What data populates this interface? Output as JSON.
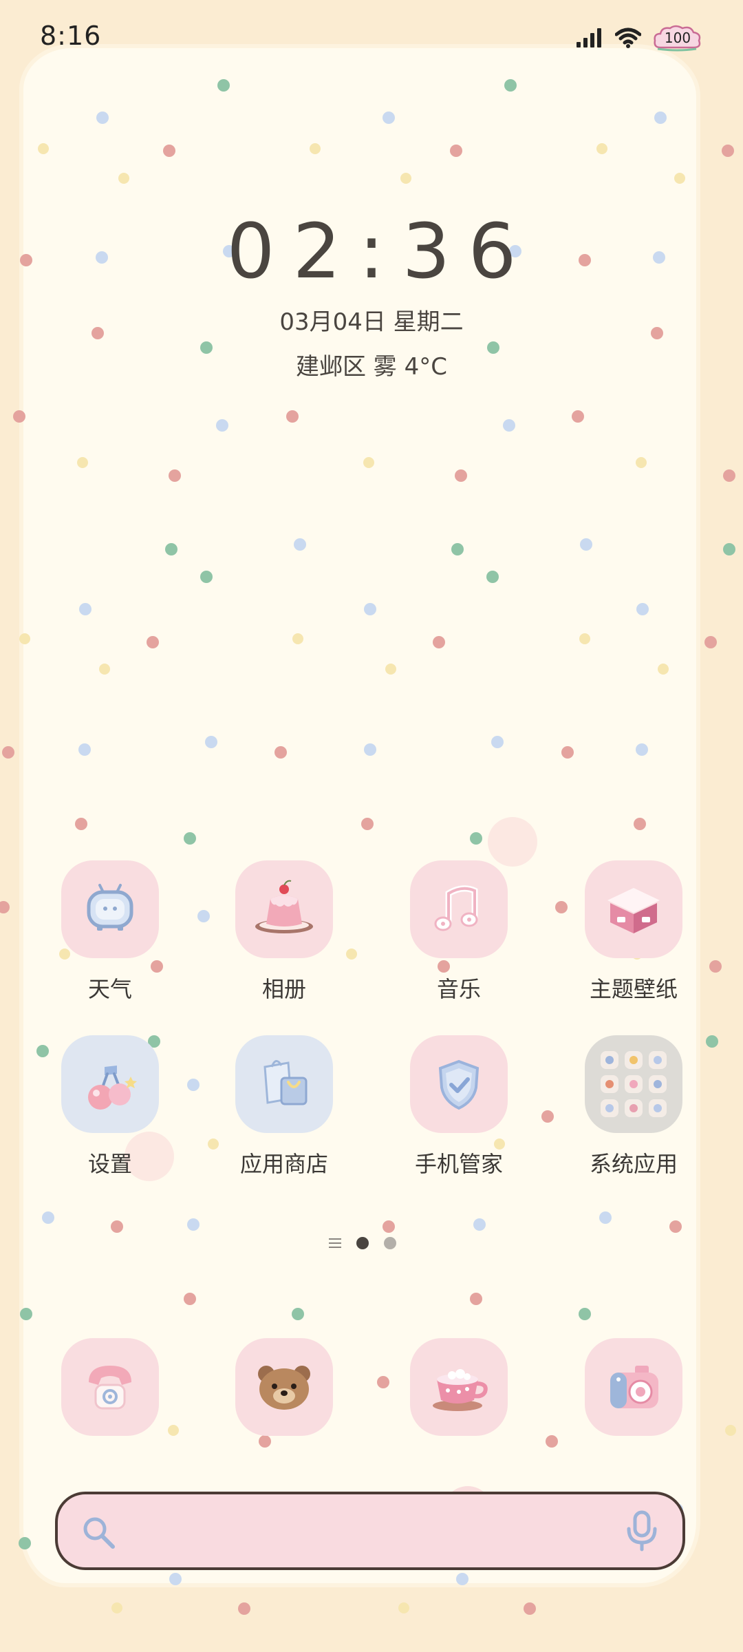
{
  "status_bar": {
    "time": "8:16",
    "battery": "100"
  },
  "clock_widget": {
    "time": "02:36",
    "date": "03月04日 星期二",
    "weather": "建邺区 雾 4°C"
  },
  "apps": [
    {
      "label": "天气",
      "icon": "weather-tv-icon"
    },
    {
      "label": "相册",
      "icon": "pudding-icon"
    },
    {
      "label": "音乐",
      "icon": "music-note-icon"
    },
    {
      "label": "主题壁纸",
      "icon": "theme-box-icon"
    },
    {
      "label": "设置",
      "icon": "cherry-icon"
    },
    {
      "label": "应用商店",
      "icon": "shopping-bag-icon"
    },
    {
      "label": "手机管家",
      "icon": "shield-check-icon"
    },
    {
      "label": "系统应用",
      "icon": "folder-grid-icon"
    }
  ],
  "dock": [
    {
      "icon": "telephone-icon"
    },
    {
      "icon": "bear-icon"
    },
    {
      "icon": "teacup-icon"
    },
    {
      "icon": "camera-icon"
    }
  ],
  "pager": {
    "current_page": 2,
    "total_pages": 2
  },
  "search": {
    "placeholder": ""
  },
  "colors": {
    "background": "#fbecd2",
    "paper": "#fffbef",
    "tile_pink": "#f9dde0",
    "tile_blue": "#dfe6f1",
    "text": "#3b3835",
    "dot_red": "#e4a39e",
    "dot_green": "#8fc4a6",
    "dot_blue": "#c9d9f0",
    "dot_yellow": "#f6e6b0"
  }
}
